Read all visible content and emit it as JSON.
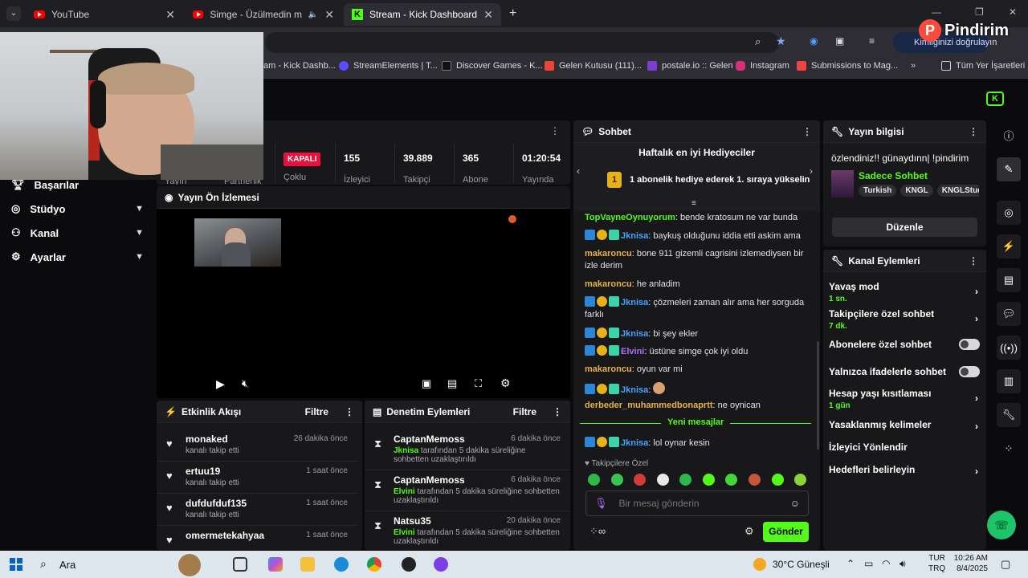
{
  "browser": {
    "tabs": [
      {
        "title": "YouTube",
        "icon": "youtube-icon"
      },
      {
        "title": "Simge - Üzülmedin mi? - Yo",
        "icon": "youtube-icon"
      },
      {
        "title": "Stream - Kick Dashboard",
        "icon": "kick-icon"
      }
    ],
    "verify_button": "Kimliğinizi doğrulayın",
    "bookmarks": [
      "am - Kick Dashb...",
      "StreamElements | T...",
      "Discover Games - K...",
      "Gelen Kutusu (111)...",
      "postale.io :: Gelen",
      "Instagram",
      "Submissions to Mag...",
      "Tüm Yer İşaretleri"
    ]
  },
  "watermark": "Pindirim",
  "sidebar": {
    "items": [
      {
        "label": "Başarılar",
        "has_chevron": false
      },
      {
        "label": "Stüdyo",
        "has_chevron": true
      },
      {
        "label": "Kanal",
        "has_chevron": true
      },
      {
        "label": "Ayarlar",
        "has_chevron": true
      }
    ]
  },
  "stats": {
    "partial_left": [
      "Yayın",
      "Partnerlik"
    ],
    "status_badge": "KAPALI",
    "status_label": "Çoklu",
    "items": [
      {
        "value": "155",
        "label": "İzleyici"
      },
      {
        "value": "39.889",
        "label": "Takipçi"
      },
      {
        "value": "365",
        "label": "Abone"
      },
      {
        "value": "01:20:54",
        "label": "Yayında"
      }
    ]
  },
  "preview": {
    "title": "Yayın Ön İzlemesi"
  },
  "activity": {
    "title": "Etkinlik Akışı",
    "filter": "Filtre",
    "rows": [
      {
        "name": "monaked",
        "desc": "kanalı takip etti",
        "time": "26 dakika önce"
      },
      {
        "name": "ertuu19",
        "desc": "kanalı takip etti",
        "time": "1 saat önce"
      },
      {
        "name": "dufdufduf135",
        "desc": "kanalı takip etti",
        "time": "1 saat önce"
      },
      {
        "name": "omermetekahyaa",
        "desc": "",
        "time": "1 saat önce"
      }
    ]
  },
  "moderation": {
    "title": "Denetim Eylemleri",
    "filter": "Filtre",
    "rows": [
      {
        "name": "CaptanMemoss",
        "by": "Jknisa",
        "desc": "tarafından 5 dakika süreliğine sohbetten uzaklaştırıldı",
        "time": "6 dakika önce"
      },
      {
        "name": "CaptanMemoss",
        "by": "Elvini",
        "desc": "tarafından 5 dakika süreliğine sohbetten uzaklaştırıldı",
        "time": "6 dakika önce"
      },
      {
        "name": "Natsu35",
        "by": "Elvini",
        "desc": "tarafından 5 dakika süreliğine sohbetten uzaklaştırıldı",
        "time": "20 dakika önce"
      }
    ]
  },
  "chat": {
    "title": "Sohbet",
    "gifters_title": "Haftalık en iyi Hediyeciler",
    "gifters_rank": "1",
    "gifters_text": "1 abonelik hediye ederek 1. sıraya yükselin",
    "messages": [
      {
        "user": "TopVayneOynuyorum",
        "text": "bende kratosum ne var bunda"
      },
      {
        "user": "Jknisa",
        "text": "baykuş olduğunu iddia etti askim ama"
      },
      {
        "user": "makaroncu",
        "text": "bone 911 gizemli cagrisini izlemediysen bir izle derim"
      },
      {
        "user": "makaroncu",
        "text": "he anladim"
      },
      {
        "user": "Jknisa",
        "text": "çözmeleri zaman alır ama her sorguda farklı"
      },
      {
        "user": "Jknisa",
        "text": "bi şey ekler"
      },
      {
        "user": "Elvini",
        "text": "üstüne simge çok iyi oldu"
      },
      {
        "user": "makaroncu",
        "text": "oyun var mi"
      },
      {
        "user": "Jknisa",
        "text": ""
      },
      {
        "user": "derbeder_muhammedbonaprtt",
        "text": "ne oynican"
      },
      {
        "user": "Jknisa",
        "text": "lol oynar kesin"
      }
    ],
    "new_messages": "Yeni mesajlar",
    "followers_only": "Takipçilere Özel",
    "input_placeholder": "Bir mesaj gönderin",
    "send_button": "Gönder",
    "rank_badge": "1"
  },
  "stream_info": {
    "title": "Yayın bilgisi",
    "stream_title": "özlendiniz!! günaydınn| !pindirim",
    "category": "Sadece Sohbet",
    "tags": [
      "Turkish",
      "KNGL",
      "KNGLStudio"
    ],
    "edit_button": "Düzenle"
  },
  "channel_actions": {
    "title": "Kanal Eylemleri",
    "rows": [
      {
        "label": "Yavaş mod",
        "sub": "1 sn.",
        "kind": "arrow"
      },
      {
        "label": "Takipçilere özel sohbet",
        "sub": "7 dk.",
        "kind": "arrow"
      },
      {
        "label": "Abonelere özel sohbet",
        "sub": "",
        "kind": "toggle"
      },
      {
        "label": "Yalnızca ifadelerle sohbet",
        "sub": "",
        "kind": "toggle"
      },
      {
        "label": "Hesap yaşı kısıtlaması",
        "sub": "1 gün",
        "kind": "arrow"
      },
      {
        "label": "Yasaklanmış kelimeler",
        "sub": "",
        "kind": "arrow"
      },
      {
        "label": "İzleyici Yönlendir",
        "sub": "",
        "kind": "none"
      },
      {
        "label": "Hedefleri belirleyin",
        "sub": "",
        "kind": "arrow"
      }
    ]
  },
  "taskbar": {
    "search": "Ara",
    "weather": "30°C",
    "weather_desc": "Güneşli",
    "lang1": "TUR",
    "lang2": "TRQ",
    "time": "10:26 AM",
    "date": "8/4/2025"
  },
  "colors": {
    "accent": "#53fc18",
    "live_badge": "#e9113c",
    "panel": "#18181b"
  }
}
